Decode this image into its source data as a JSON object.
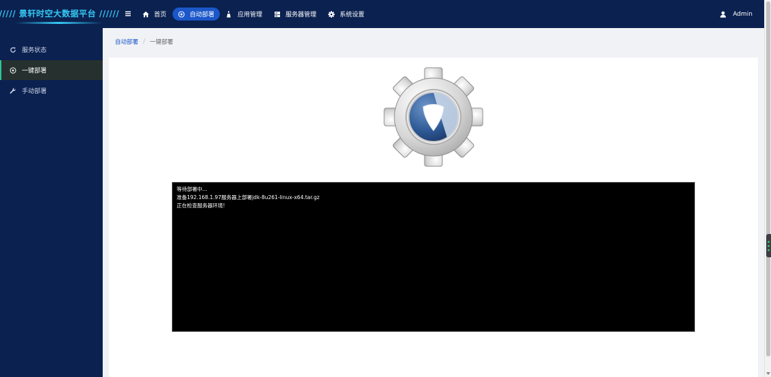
{
  "header": {
    "logo_text": "////// 景轩时空大数据平台 //////",
    "nav": [
      {
        "label": "首页",
        "icon": "home-icon",
        "active": false
      },
      {
        "label": "自动部署",
        "icon": "target-icon",
        "active": true
      },
      {
        "label": "应用管理",
        "icon": "app-icon",
        "active": false
      },
      {
        "label": "服务器管理",
        "icon": "server-icon",
        "active": false
      },
      {
        "label": "系统设置",
        "icon": "gear-icon",
        "active": false
      }
    ],
    "user": "Admin"
  },
  "sidebar": {
    "items": [
      {
        "label": "服务状态",
        "icon": "refresh-icon",
        "active": false
      },
      {
        "label": "一键部署",
        "icon": "target-icon",
        "active": true
      },
      {
        "label": "手动部署",
        "icon": "wrench-icon",
        "active": false
      }
    ]
  },
  "breadcrumb": {
    "parent": "自动部署",
    "separator": "/",
    "current": "一键部署"
  },
  "console": {
    "lines": [
      "等待部署中...",
      "准备192.168.1.97服务器上部署jdk-8u261-linux-x64.tar.gz",
      "正在检查服务器环境!"
    ]
  },
  "colors": {
    "header_bg": "#0b2150",
    "accent": "#1b57c9",
    "logo": "#35c8f5",
    "sidebar_active_marker": "#2ec59a"
  }
}
